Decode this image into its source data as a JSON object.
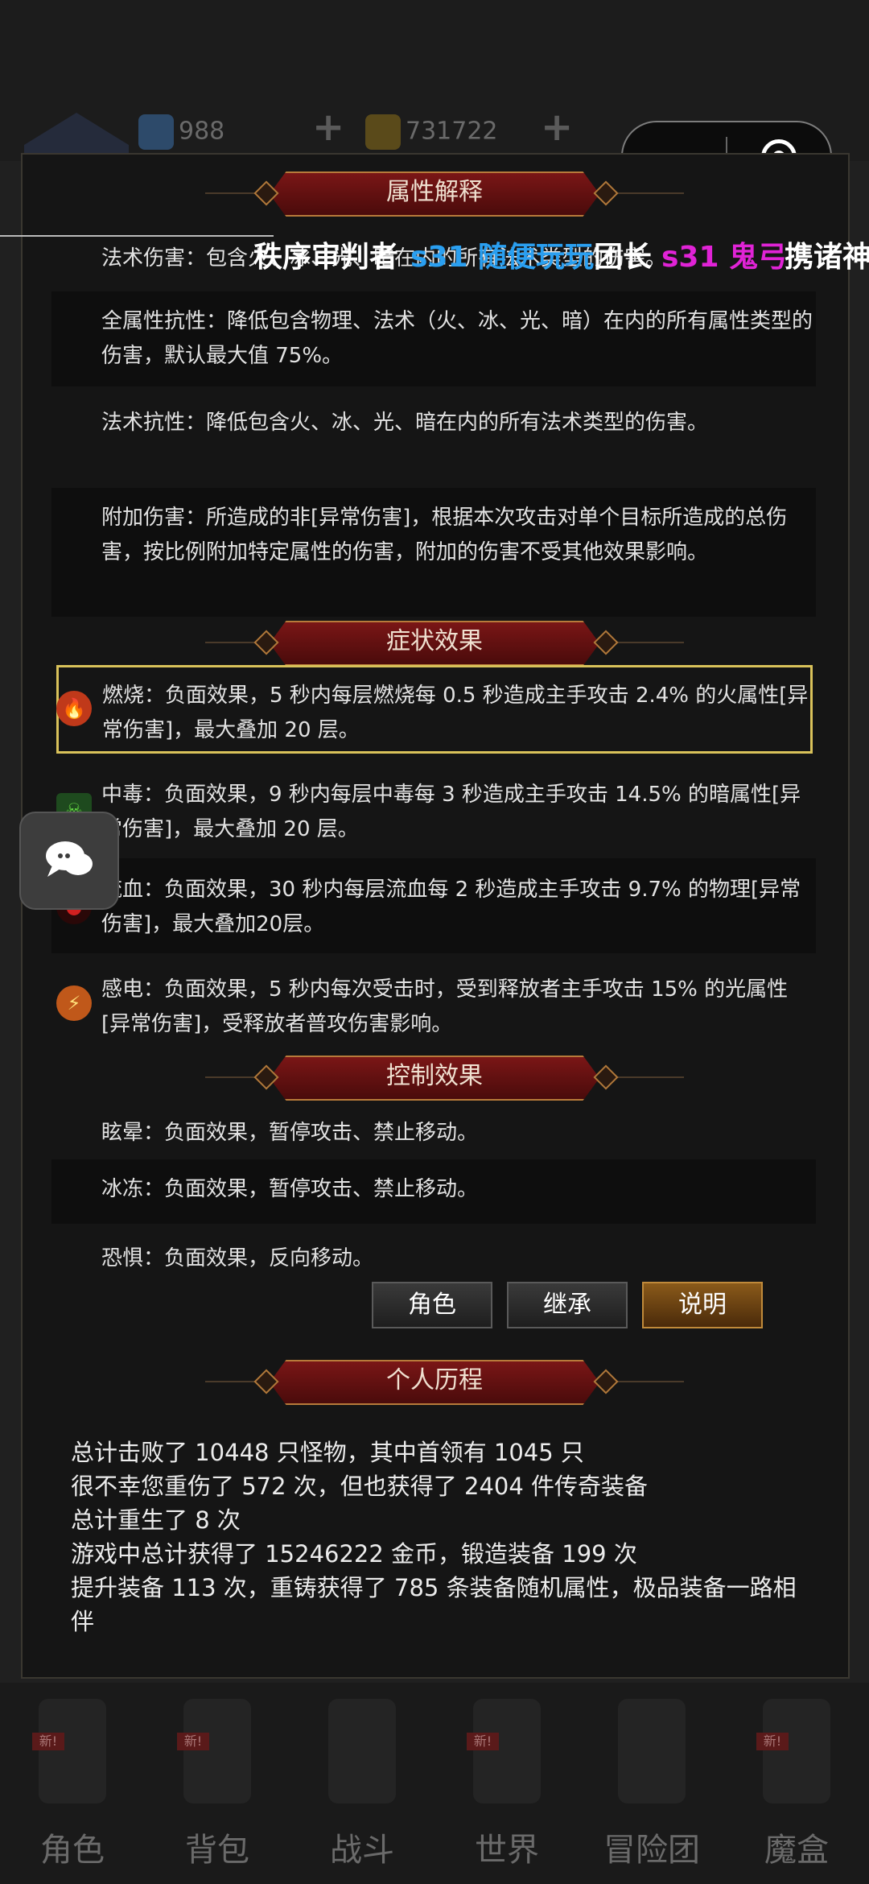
{
  "top_bar": {
    "gems": "988",
    "gold": "731722"
  },
  "capsule": {
    "more_label": "•••"
  },
  "danmaku": [
    {
      "text": "秩序审判者",
      "color": "#ffffff"
    },
    {
      "text": "s31 随便玩玩",
      "color": "#2a9ff0"
    },
    {
      "text": "团长",
      "color": "#ffffff"
    },
    {
      "text": "s31 鬼弓",
      "color": "#e023d6"
    },
    {
      "text": "携诸神",
      "color": "#ffffff"
    }
  ],
  "sections": {
    "attr_title": "属性解释",
    "status_title": "症状效果",
    "control_title": "控制效果",
    "history_title": "个人历程"
  },
  "attributes": [
    {
      "text": "法术伤害：包含火、冰、光、暗在内的所有法术类型的伤害。"
    },
    {
      "text": "全属性抗性：降低包含物理、法术（火、冰、光、暗）在内的所有属性类型的伤害，默认最大值 75%。"
    },
    {
      "text": "法术抗性：降低包含火、冰、光、暗在内的所有法术类型的伤害。"
    },
    {
      "text": "附加伤害：所造成的非[异常伤害]，根据本次攻击对单个目标所造成的总伤害，按比例附加特定属性的伤害，附加的伤害不受其他效果影响。"
    }
  ],
  "statuses": [
    {
      "icon": "fire-icon",
      "color": "#c0391a",
      "text": "燃烧：负面效果，5 秒内每层燃烧每 0.5 秒造成主手攻击 2.4% 的火属性[异常伤害]，最大叠加 20 层。"
    },
    {
      "icon": "poison-icon",
      "color": "#3a9a2a",
      "text": "中毒：负面效果，9 秒内每层中毒每 3 秒造成主手攻击 14.5% 的暗属性[异常伤害]，最大叠加 20 层。"
    },
    {
      "icon": "bleed-icon",
      "color": "#b01818",
      "text": "流血：负面效果，30 秒内每层流血每 2 秒造成主手攻击 9.7% 的物理[异常伤害]，最大叠加20层。"
    },
    {
      "icon": "lightning-icon",
      "color": "#d07020",
      "text": "感电：负面效果，5 秒内每次受击时，受到释放者主手攻击 15% 的光属性[异常伤害]，受释放者普攻伤害影响。"
    }
  ],
  "controls": [
    {
      "text": "眩晕：负面效果，暂停攻击、禁止移动。"
    },
    {
      "text": "冰冻：负面效果，暂停攻击、禁止移动。"
    },
    {
      "text": "恐惧：负面效果，反向移动。"
    }
  ],
  "tabs": [
    {
      "label": "角色",
      "active": false
    },
    {
      "label": "继承",
      "active": false
    },
    {
      "label": "说明",
      "active": true
    }
  ],
  "history": [
    "总计击败了 10448 只怪物，其中首领有 1045 只",
    "很不幸您重伤了 572 次，但也获得了 2404 件传奇装备",
    "总计重生了 8 次",
    "游戏中总计获得了 15246222 金币，锻造装备 199 次",
    "提升装备 113 次，重铸获得了 785 条装备随机属性，极品装备一路相伴"
  ],
  "bottom_nav": [
    {
      "label": "角色",
      "badge": "新!"
    },
    {
      "label": "背包",
      "badge": "新!"
    },
    {
      "label": "战斗",
      "badge": ""
    },
    {
      "label": "世界",
      "badge": "新!"
    },
    {
      "label": "冒险团",
      "badge": ""
    },
    {
      "label": "魔盒",
      "badge": "新!"
    }
  ]
}
